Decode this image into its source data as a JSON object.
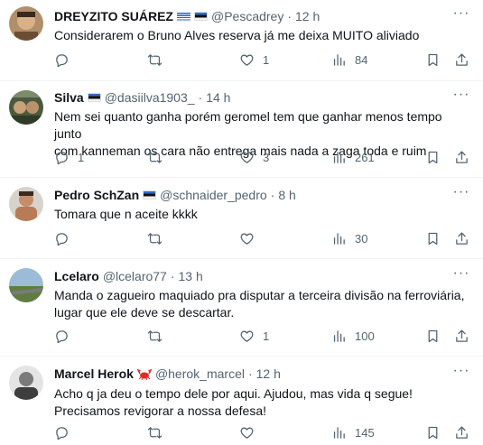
{
  "tweets": [
    {
      "name": "DREYZITO SUÁREZ",
      "flags": [
        "uruguay-flag",
        "estonia-flag"
      ],
      "handle": "@Pescadrey",
      "dot": "·",
      "time": "12 h",
      "lines": [
        "Considerarem o Bruno Alves reserva já me deixa MUITO aliviado"
      ],
      "replies": "",
      "retweets": "",
      "likes": "1",
      "views": "84"
    },
    {
      "name": "Silva",
      "flags": [
        "estonia-flag"
      ],
      "handle": "@dasiilva1903_",
      "dot": "·",
      "time": "14 h",
      "lines": [
        "Nem sei quanto ganha porém geromel tem que ganhar menos tempo junto",
        "com kanneman os cara não entrega mais nada a zaga toda e ruim"
      ],
      "replies": "1",
      "retweets": "",
      "likes": "3",
      "views": "261"
    },
    {
      "name": "Pedro SchZan",
      "flags": [
        "estonia-flag"
      ],
      "handle": "@schnaider_pedro",
      "dot": "·",
      "time": "8 h",
      "lines": [
        "Tomara que n aceite kkkk"
      ],
      "replies": "",
      "retweets": "",
      "likes": "",
      "views": "30"
    },
    {
      "name": "Lcelaro",
      "flags": [],
      "handle": "@lcelaro77",
      "dot": "·",
      "time": "13 h",
      "lines": [
        "Manda o zagueiro maquiado pra disputar a terceira divisão na ferroviária,",
        "lugar que ele deve se descartar."
      ],
      "replies": "",
      "retweets": "",
      "likes": "1",
      "views": "100"
    },
    {
      "name": "Marcel Herok",
      "flags": [
        "crab-emoji"
      ],
      "handle": "@herok_marcel",
      "dot": "·",
      "time": "12 h",
      "lines": [
        "Acho q ja deu o tempo dele por aqui. Ajudou, mas vida q segue!",
        "Precisamos revigorar a nossa defesa!"
      ],
      "replies": "",
      "retweets": "",
      "likes": "",
      "views": "145"
    }
  ],
  "icons": {
    "reply": "reply-icon",
    "retweet": "retweet-icon",
    "like": "heart-icon",
    "views": "views-icon",
    "bookmark": "bookmark-icon",
    "share": "share-icon",
    "more": "more-icon"
  },
  "colors": {
    "text": "#0f1419",
    "secondary": "#536471",
    "divider": "#eff3f4"
  }
}
